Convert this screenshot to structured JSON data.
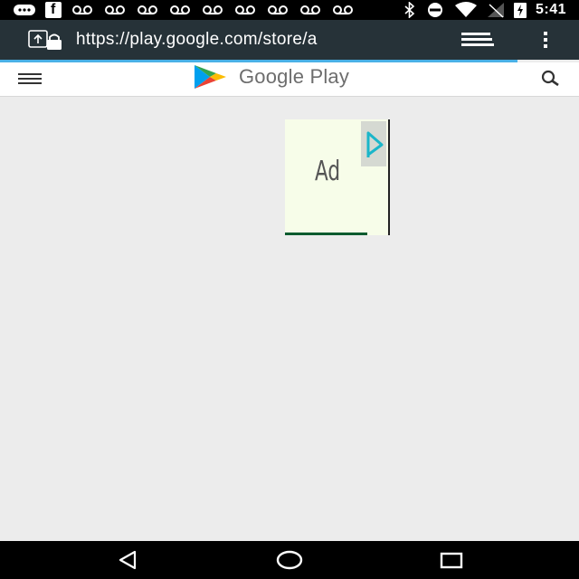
{
  "status_bar": {
    "time": "5:41",
    "icons": [
      "message-icon",
      "facebook-icon",
      "voicemail-icon",
      "bluetooth-icon",
      "do-not-disturb-icon",
      "wifi-icon",
      "no-signal-icon",
      "battery-charging-icon"
    ]
  },
  "url_bar": {
    "url": "https://play.google.com/store/a",
    "secure_icon": "data-saver-lock-icon",
    "tabs_icon": "tabs-icon",
    "menu_icon": "overflow-menu-icon"
  },
  "app_header": {
    "brand": "Google Play",
    "menu_icon": "hamburger-icon",
    "search_icon": "search-icon"
  },
  "ad": {
    "label": "Ad",
    "choice_icon": "adchoices-icon"
  },
  "nav_bar": {
    "buttons": [
      "back-icon",
      "home-icon",
      "recents-icon"
    ]
  },
  "colors": {
    "status_bar": "#000000",
    "url_bar": "#263238",
    "progress": "#4ab0e6",
    "page_background": "#ececec",
    "ad_background": "#f7fde9",
    "ad_icon": "#1ab6c9"
  }
}
